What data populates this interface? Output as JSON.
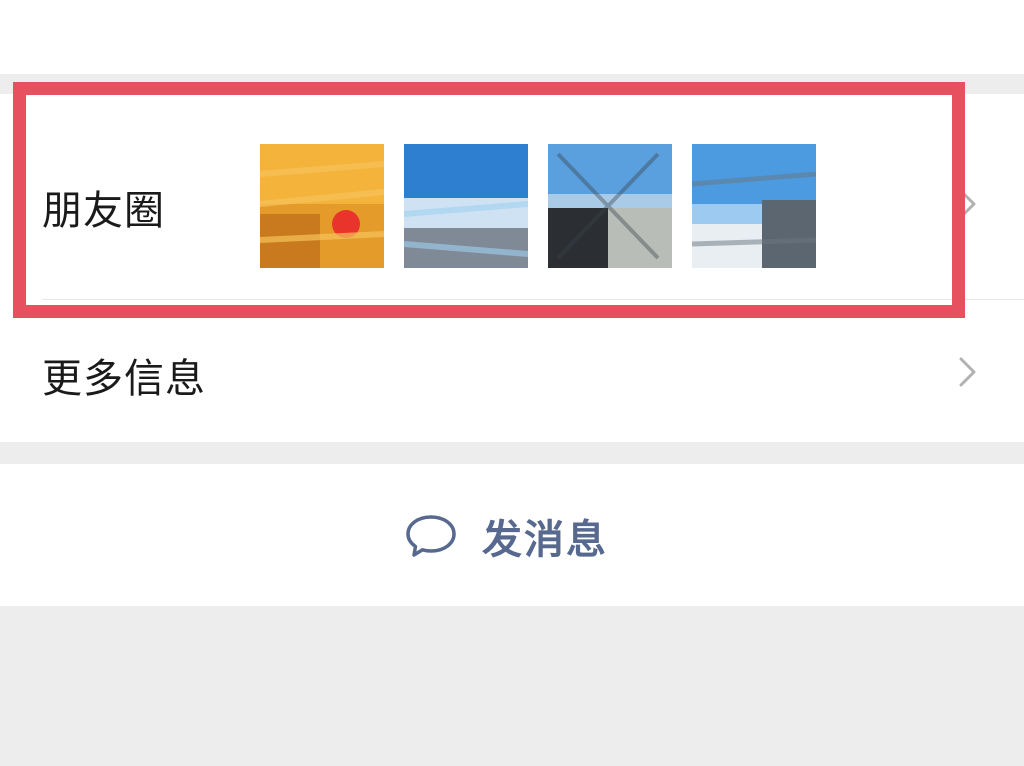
{
  "moments_row": {
    "label": "朋友圈",
    "photos": [
      {
        "name": "moments-photo-1",
        "colors": [
          "#e59b2a",
          "#f4b43c",
          "#c97a1e",
          "#e8342a"
        ]
      },
      {
        "name": "moments-photo-2",
        "colors": [
          "#2f7fd1",
          "#7ab7e8",
          "#cfe2f3",
          "#7f8a96"
        ]
      },
      {
        "name": "moments-photo-3",
        "colors": [
          "#5aa0de",
          "#a9cbe8",
          "#2b2f33",
          "#b9bdb8"
        ]
      },
      {
        "name": "moments-photo-4",
        "colors": [
          "#4c9be0",
          "#9ccaf0",
          "#5c6670",
          "#e8eef2"
        ]
      }
    ]
  },
  "more_info_row": {
    "label": "更多信息"
  },
  "send_message": {
    "label": "发消息",
    "icon": "chat-bubble-icon"
  },
  "highlight": {
    "color": "#e7515f"
  },
  "colors": {
    "accent": "#57698f",
    "chevron": "#b2b2b2",
    "background": "#ededed"
  }
}
